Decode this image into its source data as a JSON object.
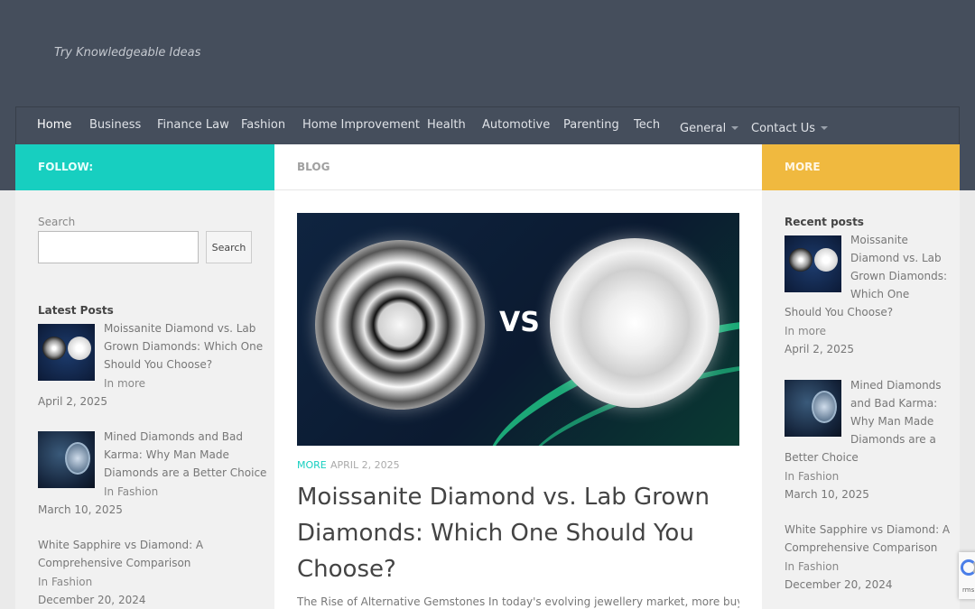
{
  "site": {
    "tagline": "Try Knowledgeable Ideas"
  },
  "nav": {
    "items": [
      {
        "label": "Home"
      },
      {
        "label": "Business"
      },
      {
        "label": "Finance Law"
      },
      {
        "label": "Fashion"
      },
      {
        "label": "Home Improvement"
      },
      {
        "label": "Health"
      },
      {
        "label": "Automotive"
      },
      {
        "label": "Parenting"
      },
      {
        "label": "Tech"
      },
      {
        "label": "General"
      },
      {
        "label": "Contact Us"
      }
    ]
  },
  "left_sidebar": {
    "header": "FOLLOW:",
    "search_label": "Search",
    "search_input_value": "",
    "search_button": "Search",
    "latest_posts_title": "Latest Posts",
    "posts": [
      {
        "title_lines": [
          "Moissanite Diamond vs. Lab",
          "Grown Diamonds: Which One",
          "Should You Choose?"
        ],
        "category": "In more",
        "date": "April 2, 2025"
      },
      {
        "title_lines": [
          "Mined Diamonds and Bad",
          "Karma: Why Man Made",
          "Diamonds are a Better Choice"
        ],
        "category": "In Fashion",
        "date": "March 10, 2025"
      },
      {
        "title_lines": [
          "White Sapphire vs Diamond: A",
          "Comprehensive Comparison"
        ],
        "category": "In Fashion",
        "date": "December 20, 2024"
      }
    ]
  },
  "main": {
    "header": "BLOG",
    "hero_text": "VS",
    "category": "MORE",
    "date": "APRIL 2, 2025",
    "title_lines": [
      "Moissanite Diamond vs. Lab Grown",
      "Diamonds: Which One Should You",
      "Choose?"
    ],
    "excerpt": "The Rise of Alternative Gemstones In today's evolving jewellery market, more buyers"
  },
  "right_sidebar": {
    "header": "MORE",
    "recent_title": "Recent posts",
    "posts": [
      {
        "title_lines": [
          "Moissanite",
          "Diamond vs. Lab",
          "Grown Diamonds:",
          "Which One",
          "Should You Choose?"
        ],
        "category": "In more",
        "date": "April 2, 2025"
      },
      {
        "title_lines": [
          "Mined Diamonds",
          "and Bad Karma:",
          "Why Man Made",
          "Diamonds are a",
          "Better Choice"
        ],
        "category": "In Fashion",
        "date": "March 10, 2025"
      },
      {
        "title_lines": [
          "White Sapphire vs Diamond: A",
          "Comprehensive Comparison"
        ],
        "category": "In Fashion",
        "date": "December 20, 2024"
      }
    ]
  },
  "recaptcha": {
    "text": "rms"
  },
  "colors": {
    "header_bg": "#454e5c",
    "follow": "#17cfc0",
    "more": "#f0b93f",
    "accent_green": "#1fc084"
  }
}
